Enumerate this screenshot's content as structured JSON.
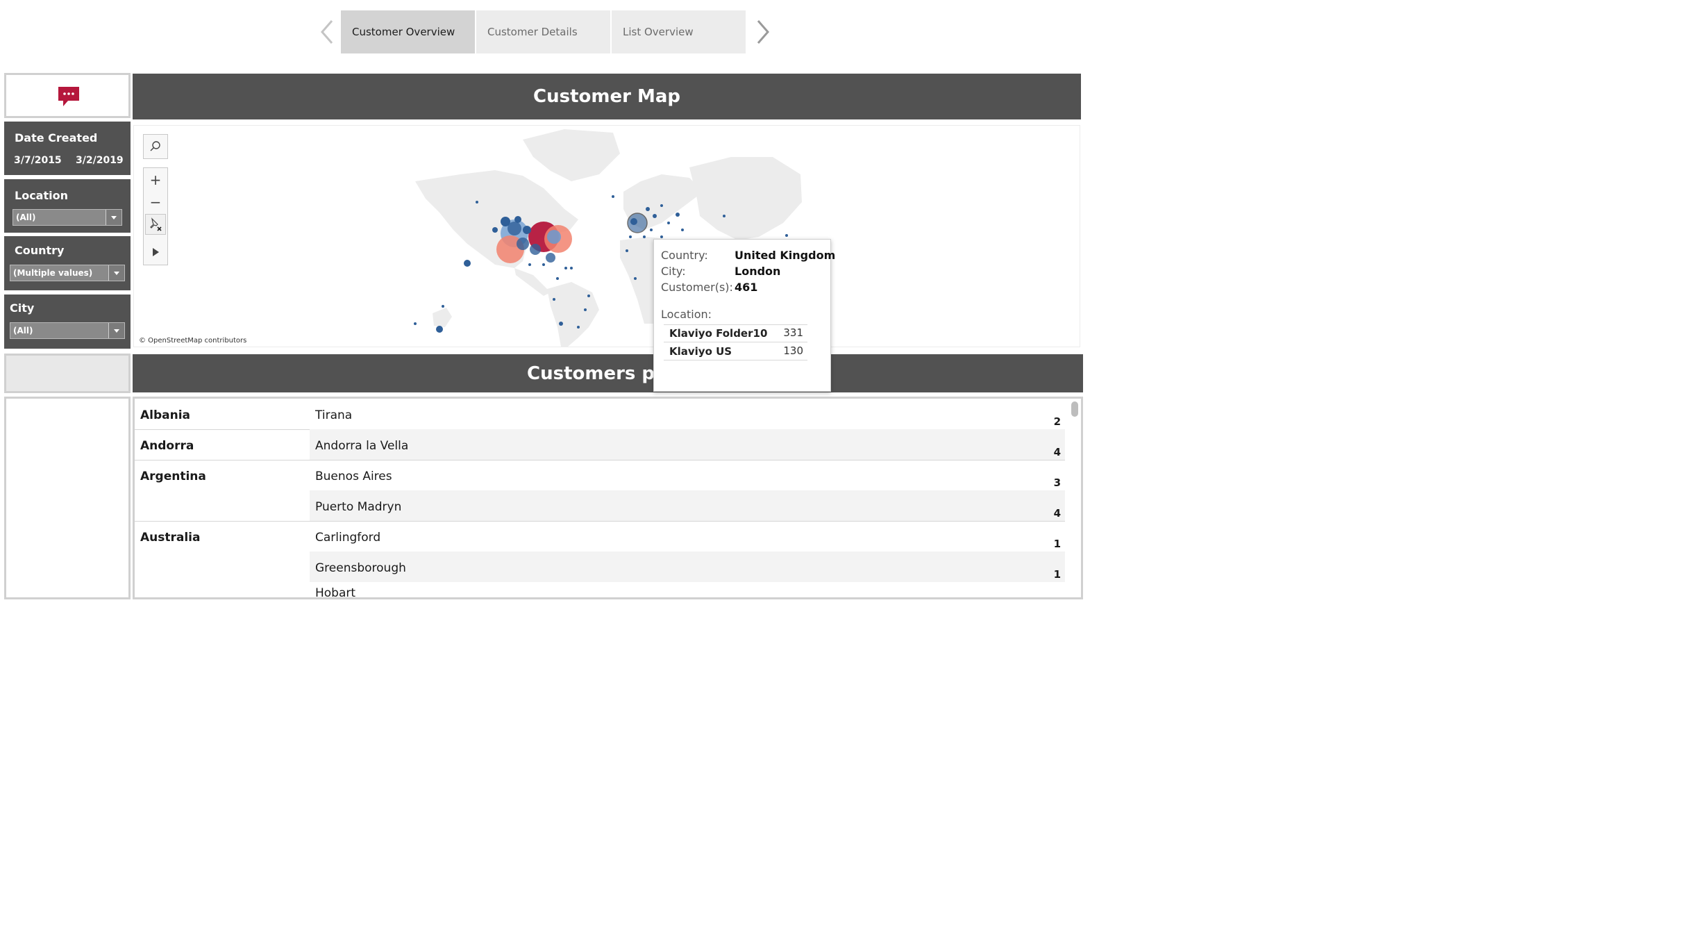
{
  "nav": {
    "tabs": [
      {
        "label": "Customer Overview",
        "active": true
      },
      {
        "label": "Customer Details",
        "active": false
      },
      {
        "label": "List Overview",
        "active": false
      }
    ],
    "prev_icon": "chevron-left-icon",
    "next_icon": "chevron-right-icon"
  },
  "sidebar": {
    "comment_icon": "speech-bubble-icon",
    "date_filter": {
      "title": "Date Created",
      "start": "3/7/2015",
      "end": "3/2/2019"
    },
    "location_filter": {
      "title": "Location",
      "value": "(All)"
    },
    "country_filter": {
      "title": "Country",
      "value": "(Multiple values)"
    },
    "city_filter": {
      "title": "City",
      "value": "(All)"
    }
  },
  "map": {
    "title": "Customer Map",
    "attribution": "© OpenStreetMap contributors",
    "tools": [
      "search-icon",
      "zoom-in-icon",
      "zoom-out-icon",
      "unpin-icon",
      "expand-arrow-icon"
    ],
    "colors": {
      "small": "#2f5f98",
      "medium": "#6a9bd1",
      "large": "#f2826e",
      "largest": "#b5173c"
    }
  },
  "tooltip": {
    "country_label": "Country:",
    "country": "United Kingdom",
    "city_label": "City:",
    "city": "London",
    "customers_label": "Customer(s):",
    "customers": "461",
    "location_label": "Location:",
    "locations": [
      {
        "name": "Klaviyo Folder10",
        "count": "331"
      },
      {
        "name": "Klaviyo US",
        "count": "130"
      }
    ]
  },
  "table": {
    "title": "Customers per",
    "rows": [
      {
        "country": "Albania",
        "city": "Tirana",
        "count": "2"
      },
      {
        "country": "Andorra",
        "city": "Andorra la Vella",
        "count": "4"
      },
      {
        "country": "Argentina",
        "city": "Buenos Aires",
        "count": "3"
      },
      {
        "country": "",
        "city": "Puerto Madryn",
        "count": "4"
      },
      {
        "country": "Australia",
        "city": "Carlingford",
        "count": "1"
      },
      {
        "country": "",
        "city": "Greensborough",
        "count": "1"
      },
      {
        "country": "",
        "city": "Hobart",
        "count": ""
      }
    ]
  }
}
